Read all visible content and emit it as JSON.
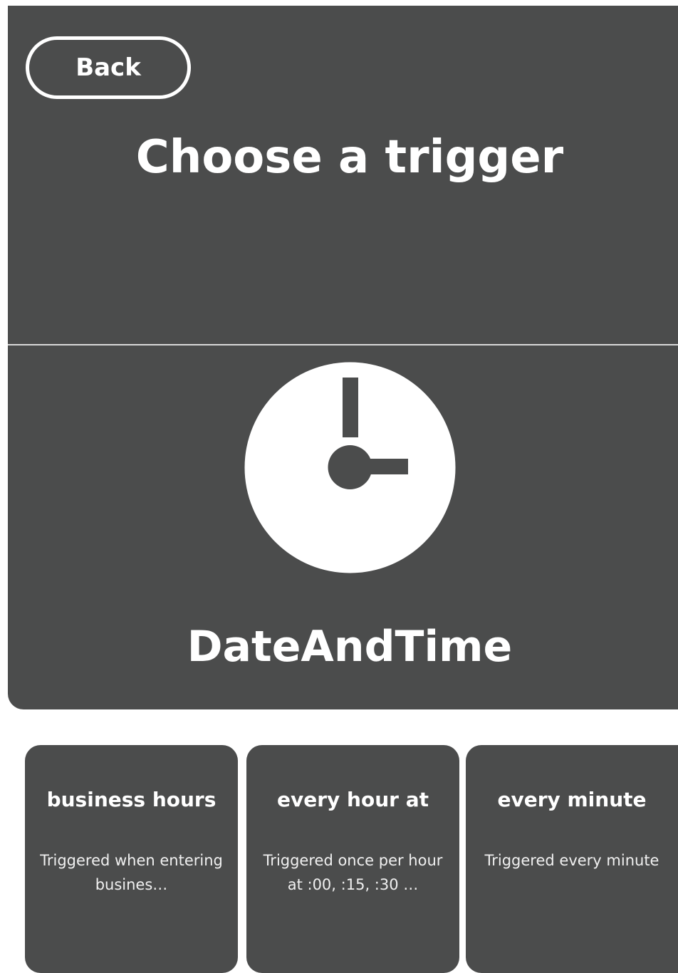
{
  "header": {
    "back_label": "Back",
    "title": "Choose a trigger"
  },
  "service": {
    "name": "DateAndTime",
    "icon": "clock-icon"
  },
  "triggers": [
    {
      "title": "business hours",
      "description": "Triggered when entering busines…"
    },
    {
      "title": "every hour at",
      "description": "Triggered once per hour at :00, :15, :30 …"
    },
    {
      "title": "every minute",
      "description": "Triggered every minute"
    }
  ],
  "colors": {
    "panel": "#4b4c4c",
    "text": "#ffffff",
    "background": "#ffffff"
  }
}
